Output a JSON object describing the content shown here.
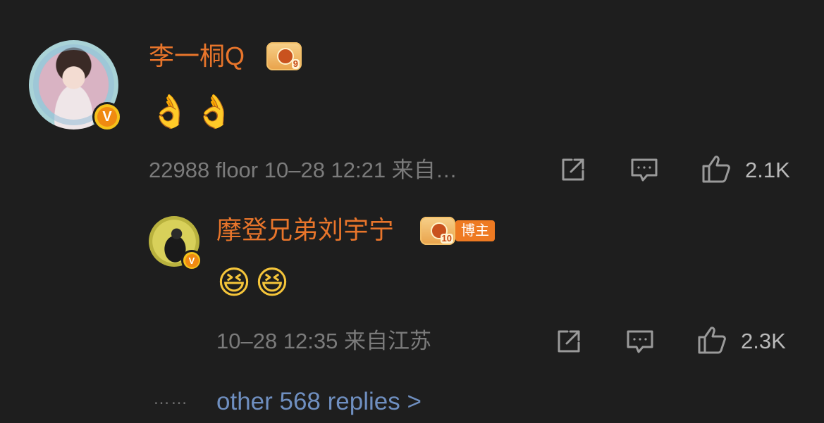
{
  "comment": {
    "username": "李一桐Q",
    "crown_level": "9",
    "emoji": "👌👌",
    "meta": "22988 floor 10–28 12:21 来自…",
    "likes": "2.1K",
    "icons": {
      "share": "share-icon",
      "comment": "comment-icon",
      "like": "thumbs-up-icon",
      "verified": "verified-v-badge"
    }
  },
  "reply": {
    "username": "摩登兄弟刘宇宁",
    "crown_level": "10",
    "blogger_tag": "博主",
    "emoji": "😆😆",
    "meta": "10–28 12:35  来自江苏",
    "likes": "2.3K",
    "icons": {
      "share": "share-icon",
      "comment": "comment-icon",
      "like": "thumbs-up-icon",
      "verified": "verified-v-badge"
    }
  },
  "more_replies": {
    "dots": "……",
    "label": "other 568 replies >"
  },
  "colors": {
    "background": "#1e1e1e",
    "username": "#e8752b",
    "meta": "#7b7b7b",
    "link": "#6f8fc0",
    "badge": "#f5c21b"
  }
}
